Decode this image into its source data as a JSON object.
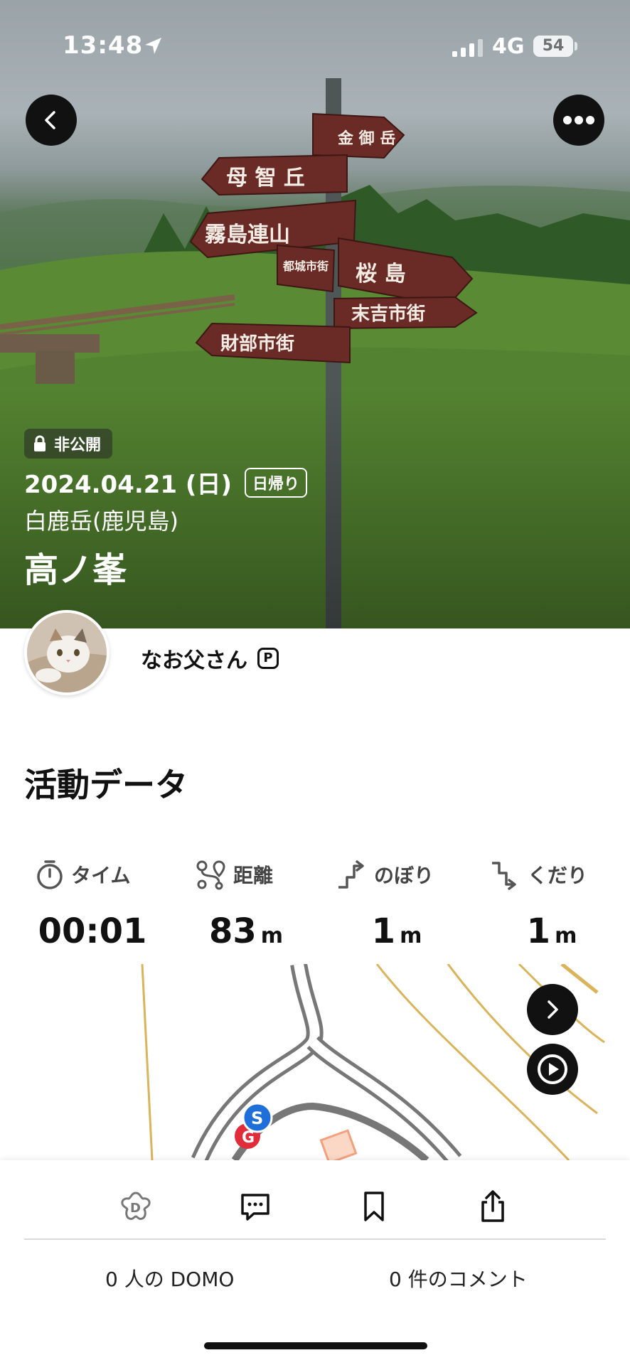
{
  "status_bar": {
    "time": "13:48",
    "network": "4G",
    "battery": "54"
  },
  "hero": {
    "privacy_label": "非公開",
    "date": "2024.04.21 (日)",
    "trip_type": "日帰り",
    "mountain": "白鹿岳(鹿児島)",
    "place": "高ノ峯",
    "signs": [
      "金御岳",
      "母智丘",
      "霧島連山",
      "都城市街",
      "桜島",
      "末吉市街",
      "財部市街"
    ]
  },
  "profile": {
    "username": "なお父さん",
    "premium_mark": "P"
  },
  "activity": {
    "title": "活動データ",
    "stats": [
      {
        "label": "タイム",
        "value": "00:01",
        "unit": "",
        "icon": "stopwatch-icon"
      },
      {
        "label": "距離",
        "value": "83",
        "unit": "m",
        "icon": "route-icon"
      },
      {
        "label": "のぼり",
        "value": "1",
        "unit": "m",
        "icon": "ascent-icon"
      },
      {
        "label": "くだり",
        "value": "1",
        "unit": "m",
        "icon": "descent-icon"
      }
    ]
  },
  "map": {
    "start_marker": "S",
    "goal_marker": "G"
  },
  "bottom_bar": {
    "domo_count": "0 人の DOMO",
    "comment_count": "0 件のコメント"
  }
}
